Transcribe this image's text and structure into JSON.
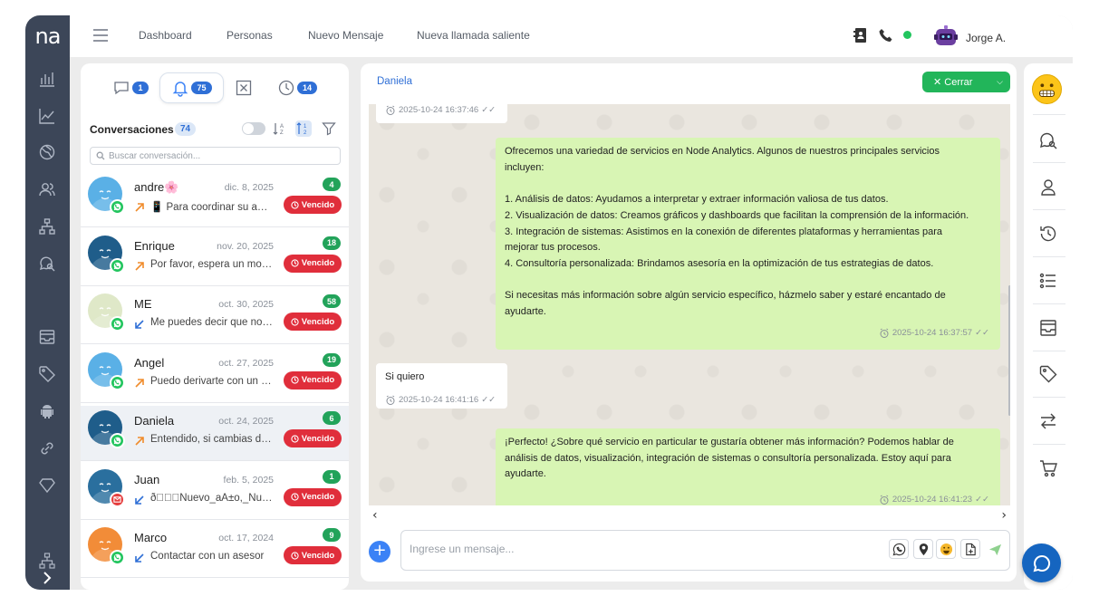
{
  "app": {
    "logo": "na"
  },
  "topbar": {
    "nav": [
      "Dashboard",
      "Personas",
      "Nuevo Mensaje",
      "Nueva llamada saliente"
    ],
    "user_name": "Jorge A."
  },
  "conversations": {
    "tabs": [
      {
        "icon": "chat-bubble-icon",
        "badge": "1"
      },
      {
        "icon": "bell-icon",
        "badge": "75"
      },
      {
        "icon": "close-box-icon",
        "badge": ""
      },
      {
        "icon": "clock-icon",
        "badge": "14"
      }
    ],
    "header": "Conversaciones",
    "count": "74",
    "search_placeholder": "Buscar conversación...",
    "items": [
      {
        "name": "andre🌸",
        "date": "dic. 8, 2025",
        "count": "4",
        "direction": "outgoing",
        "preview": "📱 Para coordinar su agenda",
        "status": "Vencido",
        "channel": "whatsapp",
        "avatar_color": "#5ab0e6"
      },
      {
        "name": "Enrique",
        "date": "nov. 20, 2025",
        "count": "18",
        "direction": "outgoing",
        "preview": "Por favor, espera un momento",
        "status": "Vencido",
        "channel": "whatsapp",
        "avatar_color": "#1f5d8a"
      },
      {
        "name": "ME",
        "date": "oct. 30, 2025",
        "count": "58",
        "direction": "incoming",
        "preview": "Me puedes decir que no entiendo",
        "status": "Vencido",
        "channel": "whatsapp",
        "avatar_color": "#dfe8c8"
      },
      {
        "name": "Angel",
        "date": "oct. 27, 2025",
        "count": "19",
        "direction": "outgoing",
        "preview": "Puedo derivarte con un asesor",
        "status": "Vencido",
        "channel": "whatsapp",
        "avatar_color": "#5ab0e6"
      },
      {
        "name": "Daniela",
        "date": "oct. 24, 2025",
        "count": "6",
        "direction": "outgoing",
        "preview": "Entendido, si cambias de opinión",
        "status": "Vencido",
        "channel": "whatsapp",
        "avatar_color": "#1f5d8a"
      },
      {
        "name": "Juan",
        "date": "feb. 5, 2025",
        "count": "1",
        "direction": "incoming",
        "preview": "ð\u0000\u0000\u0000Nuevo_aÃ±o,_Nuevos",
        "status": "Vencido",
        "channel": "mail",
        "avatar_color": "#2a6f9e"
      },
      {
        "name": "Marco",
        "date": "oct. 17, 2024",
        "count": "9",
        "direction": "incoming",
        "preview": "Contactar con un asesor",
        "status": "Vencido",
        "channel": "whatsapp",
        "avatar_color": "#f28c38"
      }
    ]
  },
  "chat": {
    "contact_name": "Daniela",
    "close_label": "Cerrar",
    "messages": [
      {
        "type": "in",
        "text": "",
        "time": "2025-10-24 16:37:46"
      },
      {
        "type": "out",
        "lines": [
          "Ofrecemos una variedad de servicios en Node Analytics. Algunos de nuestros principales servicios",
          "incluyen:",
          "",
          "1. Análisis de datos: Ayudamos a interpretar y extraer información valiosa de tus datos.",
          "2. Visualización de datos: Creamos gráficos y dashboards que facilitan la comprensión de la información.",
          "3. Integración de sistemas: Asistimos en la conexión de diferentes plataformas y herramientas para",
          "mejorar tus procesos.",
          "4. Consultoría personalizada: Brindamos asesoría en la optimización de tus estrategias de datos.",
          "",
          "Si necesitas más información sobre algún servicio específico, házmelo saber y estaré encantado de",
          "ayudarte."
        ],
        "time": "2025-10-24 16:37:57"
      },
      {
        "type": "in",
        "text": "Si quiero",
        "time": "2025-10-24 16:41:16"
      },
      {
        "type": "out",
        "lines": [
          "¡Perfecto! ¿Sobre qué servicio en particular te gustaría obtener más información? Podemos hablar de",
          "análisis de datos, visualización, integración de sistemas o consultoría personalizada. Estoy aquí para",
          "ayudarte."
        ],
        "time": "2025-10-24 16:41:23"
      }
    ],
    "input_placeholder": "Ingrese un mensaje..."
  },
  "colors": {
    "sidebar": "#3c4658",
    "accent": "#2f6fd6",
    "success": "#22b55a",
    "danger": "#e02e3b",
    "outgoing_bubble": "#d8f5b4"
  }
}
